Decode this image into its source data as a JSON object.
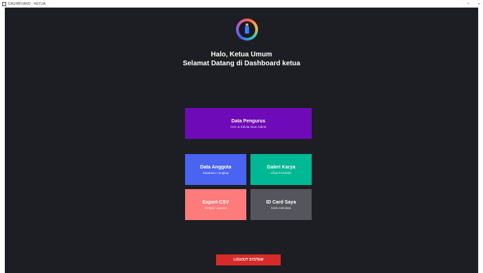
{
  "window": {
    "title": "DASHBOARD - KETUA",
    "minimize_label": "–",
    "close_label": "⌐"
  },
  "greeting": {
    "line1": "Halo, Ketua Umum",
    "line2": "Selamat Datang di Dashboard ketua"
  },
  "cards": {
    "pengurus": {
      "title": "Data Pengurus",
      "subtitle": "ACC & Kelola Akun Admin",
      "color": "#6f0ab8"
    },
    "anggota": {
      "title": "Data Anggota",
      "subtitle": "Database Lengkap",
      "color": "#4a63f0"
    },
    "galeri": {
      "title": "Galeri Karya",
      "subtitle": "Lihat Portofolio",
      "color": "#00b893"
    },
    "export": {
      "title": "Export CSV",
      "subtitle": "Simpan Laporan",
      "color": "#fd7b7b"
    },
    "idcard": {
      "title": "ID Card Saya",
      "subtitle": "Kartu Identitas",
      "color": "#54555d"
    }
  },
  "logout": {
    "label": "LOGOUT SYSTEM",
    "color": "#d92a2a"
  },
  "icons": {
    "logo": "brand-logo-icon",
    "app": "window-app-icon"
  },
  "colors": {
    "background": "#1d1e24"
  }
}
